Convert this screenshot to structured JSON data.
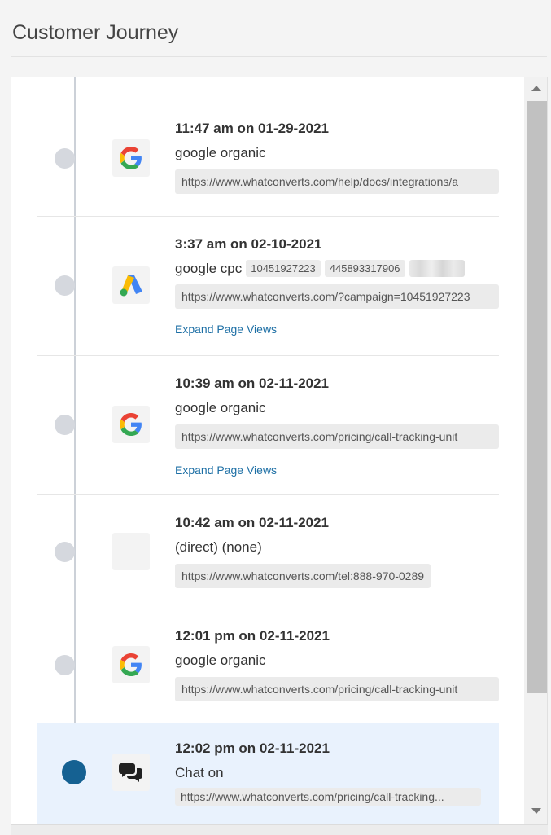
{
  "page": {
    "title": "Customer Journey"
  },
  "events": [
    {
      "time": "11:47 am on 01-29-2021",
      "source": "google organic",
      "url": "https://www.whatconverts.com/help/docs/integrations/a",
      "icon": "google-icon"
    },
    {
      "time": "3:37 am on 02-10-2021",
      "source": "google cpc",
      "tags": [
        "10451927223",
        "445893317906"
      ],
      "url": "https://www.whatconverts.com/?campaign=10451927223",
      "expand": "Expand Page Views",
      "icon": "google-ads-icon"
    },
    {
      "time": "10:39 am on 02-11-2021",
      "source": "google organic",
      "url": "https://www.whatconverts.com/pricing/call-tracking-unit",
      "expand": "Expand Page Views",
      "icon": "google-icon"
    },
    {
      "time": "10:42 am on 02-11-2021",
      "source": "(direct) (none)",
      "url": "https://www.whatconverts.com/tel:888-970-0289",
      "icon": "blank-icon"
    },
    {
      "time": "12:01 pm on 02-11-2021",
      "source": "google organic",
      "url": "https://www.whatconverts.com/pricing/call-tracking-unit",
      "icon": "google-icon"
    },
    {
      "time": "12:02 pm on 02-11-2021",
      "source": "Chat on",
      "url": "https://www.whatconverts.com/pricing/call-tracking...",
      "icon": "chat-bubbles-icon",
      "active": true
    }
  ],
  "colors": {
    "timeline_dot": "#d5d8de",
    "active_dot": "#156192",
    "active_bg": "#e9f2fd",
    "link": "#1d6fa5"
  }
}
